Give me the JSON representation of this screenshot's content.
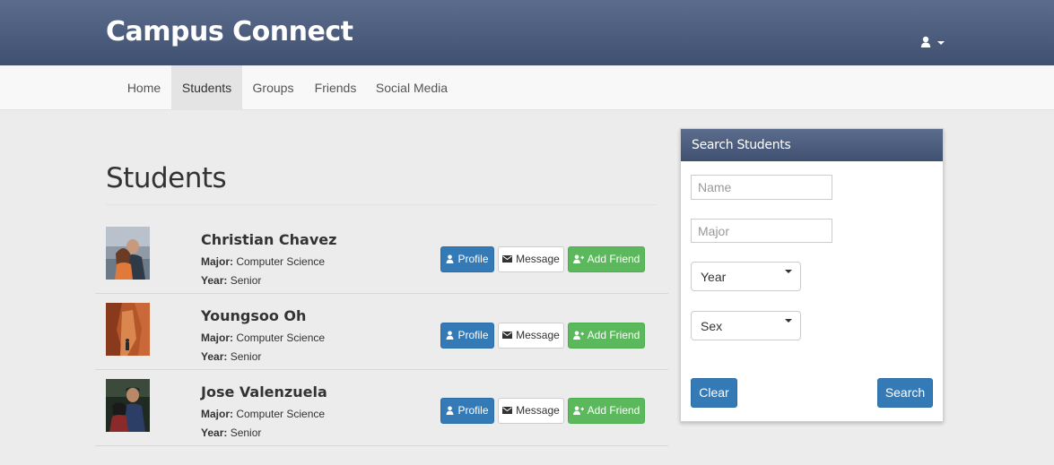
{
  "app": {
    "title": "Campus Connect"
  },
  "header": {
    "user_menu_icon": "user-icon",
    "dropdown_icon": "caret-down-icon"
  },
  "nav": {
    "items": [
      {
        "label": "Home",
        "active": false
      },
      {
        "label": "Students",
        "active": true
      },
      {
        "label": "Groups",
        "active": false
      },
      {
        "label": "Friends",
        "active": false
      },
      {
        "label": "Social Media",
        "active": false
      }
    ]
  },
  "main": {
    "title": "Students",
    "major_label": "Major:",
    "year_label": "Year:",
    "actions": {
      "profile": "Profile",
      "message": "Message",
      "add_friend": "Add Friend"
    },
    "students": [
      {
        "name": "Christian Chavez",
        "major": "Computer Science",
        "year": "Senior"
      },
      {
        "name": "Youngsoo Oh",
        "major": "Computer Science",
        "year": "Senior"
      },
      {
        "name": "Jose Valenzuela",
        "major": "Computer Science",
        "year": "Senior"
      }
    ]
  },
  "search": {
    "title": "Search Students",
    "name_placeholder": "Name",
    "major_placeholder": "Major",
    "year_value": "Year",
    "sex_value": "Sex",
    "clear_label": "Clear",
    "search_label": "Search"
  },
  "colors": {
    "header": "#4a5b7c",
    "primary": "#337ab7",
    "success": "#5cb85c"
  }
}
